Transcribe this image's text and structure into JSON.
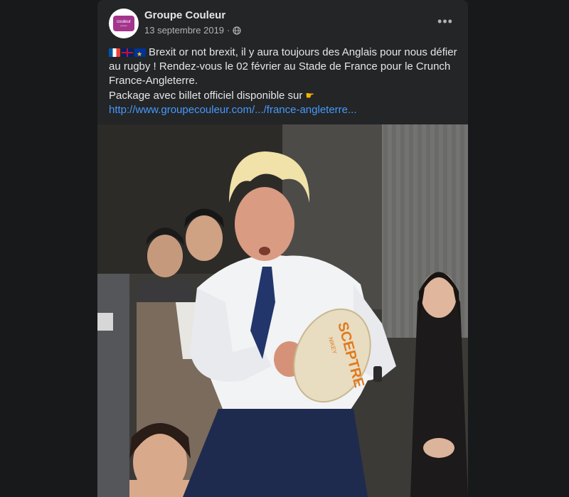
{
  "post": {
    "page_name": "Groupe Couleur",
    "date": "13 septembre 2019",
    "separator": "·",
    "avatar_text": "couleur",
    "avatar_subtext": "groupe",
    "more_label": "•••",
    "caption_line1": "Brexit or not brexit, il y aura toujours des Anglais pour nous défier au rugby ! Rendez-vous le 02 février au Stade de France pour le Crunch France-Angleterre.",
    "caption_line2": "Package avec billet officiel disponible sur",
    "link_text": "http://www.groupecouleur.com/.../france-angleterre...",
    "icons": [
      "flag-france-icon",
      "flag-uk-icon",
      "flag-eu-icon",
      "globe-icon",
      "pointing-hand-icon",
      "more-options-icon"
    ]
  },
  "photo": {
    "ball_text": "SCEPTRE",
    "ball_subtext": "NIKEY"
  },
  "colors": {
    "background": "#18191a",
    "card": "#242526",
    "text_primary": "#e4e6eb",
    "text_secondary": "#b0b3b8",
    "link": "#4599ff",
    "avatar_brand": "#a4358d"
  }
}
